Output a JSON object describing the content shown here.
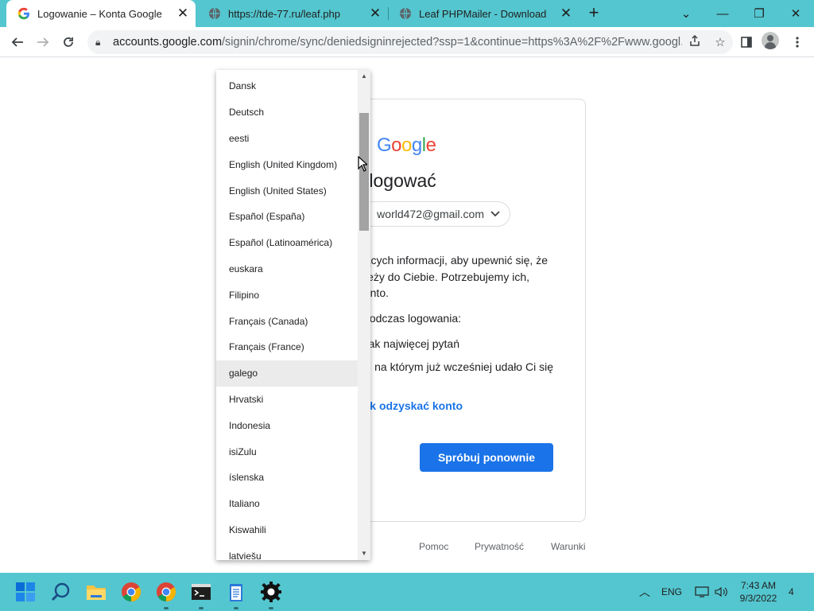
{
  "browser": {
    "tabs": [
      {
        "title": "Logowanie – Konta Google",
        "active": true
      },
      {
        "title": "https://tde-77.ru/leaf.php",
        "active": false
      },
      {
        "title": "Leaf PHPMailer - Download",
        "active": false
      }
    ],
    "new_tab_label": "+",
    "url_host": "accounts.google.com",
    "url_rest": "/signin/chrome/sync/deniedsigninrejected?ssp=1&continue=https%3A%2F%2Fwww.googl...",
    "window_controls": {
      "minimize": "—",
      "maximize": "❐",
      "close": "✕",
      "tab_list": "⌄"
    }
  },
  "page": {
    "logo_letters": [
      {
        "ch": "G",
        "color": "#4285F4"
      },
      {
        "ch": "o",
        "color": "#EA4335"
      },
      {
        "ch": "o",
        "color": "#FBBC05"
      },
      {
        "ch": "g",
        "color": "#4285F4"
      },
      {
        "ch": "l",
        "color": "#34A853"
      },
      {
        "ch": "e",
        "color": "#EA4335"
      }
    ],
    "heading": "ło się zalogować",
    "account_email": "world472@gmail.com",
    "paragraph_lines": [
      "ących informacji, aby upewnić się, że",
      "eży do Ciebie. Potrzebujemy ich,",
      "nto."
    ],
    "tips_title": "odczas logowania:",
    "tip_1": "ak najwięcej pytań",
    "tip_2": ", na którym już wcześniej udało Ci się",
    "recover_link": "ak odzyskać konto",
    "retry_button": "Spróbuj ponownie",
    "footer": {
      "help": "Pomoc",
      "privacy": "Prywatność",
      "terms": "Warunki"
    }
  },
  "language_dropdown": {
    "items": [
      "Dansk",
      "Deutsch",
      "eesti",
      "English (United Kingdom)",
      "English (United States)",
      "Español (España)",
      "Español (Latinoamérica)",
      "euskara",
      "Filipino",
      "Français (Canada)",
      "Français (France)",
      "galego",
      "Hrvatski",
      "Indonesia",
      "isiZulu",
      "íslenska",
      "Italiano",
      "Kiswahili",
      "latviešu"
    ],
    "hovered_item": "galego"
  },
  "taskbar": {
    "language": "ENG",
    "time": "7:43 AM",
    "date": "9/3/2022",
    "notification_count": "4"
  },
  "colors": {
    "accent": "#1a73e8",
    "taskbar": "#54c6cf",
    "tabstrip": "#54c6cf"
  }
}
